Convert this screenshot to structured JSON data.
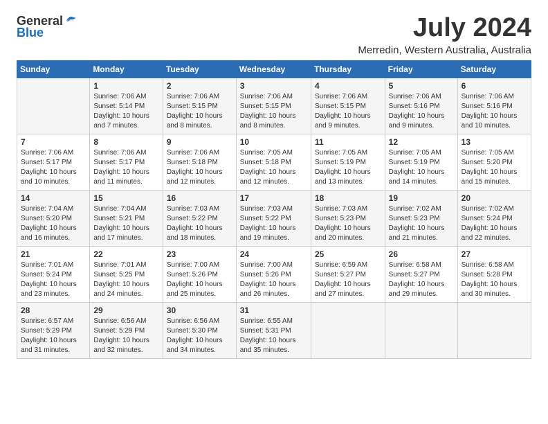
{
  "header": {
    "logo_general": "General",
    "logo_blue": "Blue",
    "month_title": "July 2024",
    "location": "Merredin, Western Australia, Australia"
  },
  "days_of_week": [
    "Sunday",
    "Monday",
    "Tuesday",
    "Wednesday",
    "Thursday",
    "Friday",
    "Saturday"
  ],
  "weeks": [
    {
      "days": [
        {
          "num": "",
          "info": ""
        },
        {
          "num": "1",
          "info": "Sunrise: 7:06 AM\nSunset: 5:14 PM\nDaylight: 10 hours\nand 7 minutes."
        },
        {
          "num": "2",
          "info": "Sunrise: 7:06 AM\nSunset: 5:15 PM\nDaylight: 10 hours\nand 8 minutes."
        },
        {
          "num": "3",
          "info": "Sunrise: 7:06 AM\nSunset: 5:15 PM\nDaylight: 10 hours\nand 8 minutes."
        },
        {
          "num": "4",
          "info": "Sunrise: 7:06 AM\nSunset: 5:15 PM\nDaylight: 10 hours\nand 9 minutes."
        },
        {
          "num": "5",
          "info": "Sunrise: 7:06 AM\nSunset: 5:16 PM\nDaylight: 10 hours\nand 9 minutes."
        },
        {
          "num": "6",
          "info": "Sunrise: 7:06 AM\nSunset: 5:16 PM\nDaylight: 10 hours\nand 10 minutes."
        }
      ]
    },
    {
      "days": [
        {
          "num": "7",
          "info": "Sunrise: 7:06 AM\nSunset: 5:17 PM\nDaylight: 10 hours\nand 10 minutes."
        },
        {
          "num": "8",
          "info": "Sunrise: 7:06 AM\nSunset: 5:17 PM\nDaylight: 10 hours\nand 11 minutes."
        },
        {
          "num": "9",
          "info": "Sunrise: 7:06 AM\nSunset: 5:18 PM\nDaylight: 10 hours\nand 12 minutes."
        },
        {
          "num": "10",
          "info": "Sunrise: 7:05 AM\nSunset: 5:18 PM\nDaylight: 10 hours\nand 12 minutes."
        },
        {
          "num": "11",
          "info": "Sunrise: 7:05 AM\nSunset: 5:19 PM\nDaylight: 10 hours\nand 13 minutes."
        },
        {
          "num": "12",
          "info": "Sunrise: 7:05 AM\nSunset: 5:19 PM\nDaylight: 10 hours\nand 14 minutes."
        },
        {
          "num": "13",
          "info": "Sunrise: 7:05 AM\nSunset: 5:20 PM\nDaylight: 10 hours\nand 15 minutes."
        }
      ]
    },
    {
      "days": [
        {
          "num": "14",
          "info": "Sunrise: 7:04 AM\nSunset: 5:20 PM\nDaylight: 10 hours\nand 16 minutes."
        },
        {
          "num": "15",
          "info": "Sunrise: 7:04 AM\nSunset: 5:21 PM\nDaylight: 10 hours\nand 17 minutes."
        },
        {
          "num": "16",
          "info": "Sunrise: 7:03 AM\nSunset: 5:22 PM\nDaylight: 10 hours\nand 18 minutes."
        },
        {
          "num": "17",
          "info": "Sunrise: 7:03 AM\nSunset: 5:22 PM\nDaylight: 10 hours\nand 19 minutes."
        },
        {
          "num": "18",
          "info": "Sunrise: 7:03 AM\nSunset: 5:23 PM\nDaylight: 10 hours\nand 20 minutes."
        },
        {
          "num": "19",
          "info": "Sunrise: 7:02 AM\nSunset: 5:23 PM\nDaylight: 10 hours\nand 21 minutes."
        },
        {
          "num": "20",
          "info": "Sunrise: 7:02 AM\nSunset: 5:24 PM\nDaylight: 10 hours\nand 22 minutes."
        }
      ]
    },
    {
      "days": [
        {
          "num": "21",
          "info": "Sunrise: 7:01 AM\nSunset: 5:24 PM\nDaylight: 10 hours\nand 23 minutes."
        },
        {
          "num": "22",
          "info": "Sunrise: 7:01 AM\nSunset: 5:25 PM\nDaylight: 10 hours\nand 24 minutes."
        },
        {
          "num": "23",
          "info": "Sunrise: 7:00 AM\nSunset: 5:26 PM\nDaylight: 10 hours\nand 25 minutes."
        },
        {
          "num": "24",
          "info": "Sunrise: 7:00 AM\nSunset: 5:26 PM\nDaylight: 10 hours\nand 26 minutes."
        },
        {
          "num": "25",
          "info": "Sunrise: 6:59 AM\nSunset: 5:27 PM\nDaylight: 10 hours\nand 27 minutes."
        },
        {
          "num": "26",
          "info": "Sunrise: 6:58 AM\nSunset: 5:27 PM\nDaylight: 10 hours\nand 29 minutes."
        },
        {
          "num": "27",
          "info": "Sunrise: 6:58 AM\nSunset: 5:28 PM\nDaylight: 10 hours\nand 30 minutes."
        }
      ]
    },
    {
      "days": [
        {
          "num": "28",
          "info": "Sunrise: 6:57 AM\nSunset: 5:29 PM\nDaylight: 10 hours\nand 31 minutes."
        },
        {
          "num": "29",
          "info": "Sunrise: 6:56 AM\nSunset: 5:29 PM\nDaylight: 10 hours\nand 32 minutes."
        },
        {
          "num": "30",
          "info": "Sunrise: 6:56 AM\nSunset: 5:30 PM\nDaylight: 10 hours\nand 34 minutes."
        },
        {
          "num": "31",
          "info": "Sunrise: 6:55 AM\nSunset: 5:31 PM\nDaylight: 10 hours\nand 35 minutes."
        },
        {
          "num": "",
          "info": ""
        },
        {
          "num": "",
          "info": ""
        },
        {
          "num": "",
          "info": ""
        }
      ]
    }
  ]
}
